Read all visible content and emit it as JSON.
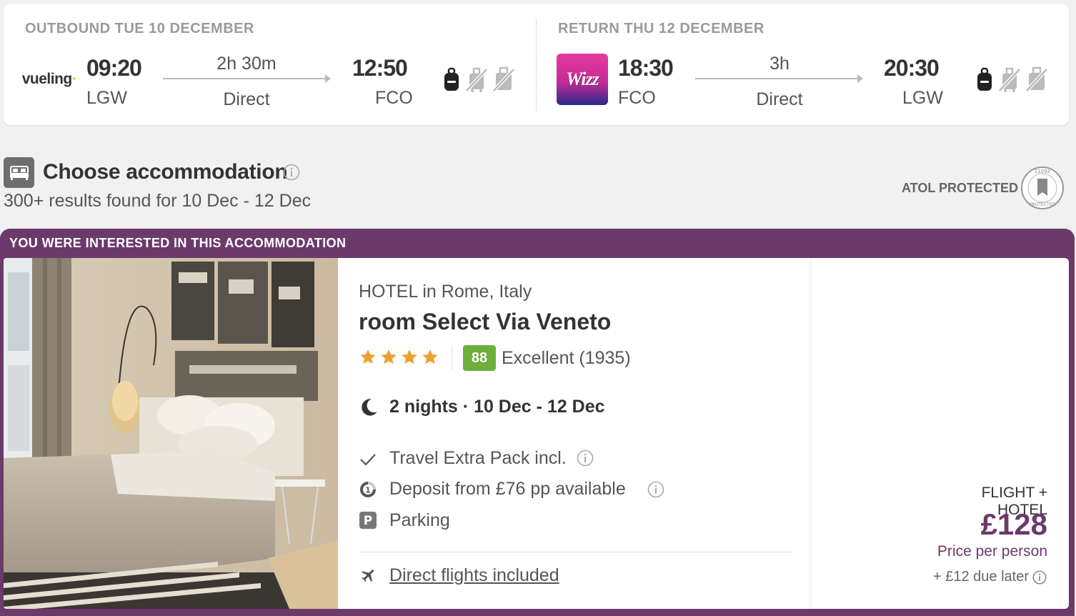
{
  "outbound": {
    "title": "OUTBOUND TUE 10 DECEMBER",
    "airline": "vueling",
    "depart_time": "09:20",
    "depart_code": "LGW",
    "duration": "2h 30m",
    "stops": "Direct",
    "arrive_time": "12:50",
    "arrive_code": "FCO",
    "baggage_icons": [
      "backpack-icon",
      "no-cabin-bag-icon",
      "no-checked-bag-icon"
    ]
  },
  "return": {
    "title": "RETURN THU 12 DECEMBER",
    "airline": "wizz",
    "depart_time": "18:30",
    "depart_code": "FCO",
    "duration": "3h",
    "stops": "Direct",
    "arrive_time": "20:30",
    "arrive_code": "LGW",
    "baggage_icons": [
      "backpack-icon",
      "no-cabin-bag-icon",
      "no-checked-bag-icon"
    ]
  },
  "accommodation": {
    "title": "Choose accommodation",
    "results": "300+ results found for 10 Dec - 12 Dec",
    "atol": "ATOL PROTECTED",
    "atol_seal": "11092 PROTECTED"
  },
  "hotel": {
    "banner": "YOU WERE INTERESTED IN THIS ACCOMMODATION",
    "type": "HOTEL in Rome, Italy",
    "name": "room Select Via Veneto",
    "stars": 4,
    "score": "88",
    "rating_text": "Excellent (1935)",
    "nights": "2 nights · 10 Dec - 12 Dec",
    "features": [
      {
        "icon": "check-icon",
        "label": "Travel Extra Pack incl.",
        "info": true
      },
      {
        "icon": "deposit-icon",
        "label": "Deposit from £76 pp available",
        "info": true
      },
      {
        "icon": "parking-icon",
        "label": "Parking",
        "info": false
      }
    ],
    "flights_link": "Direct flights included"
  },
  "price": {
    "label": "FLIGHT + HOTEL",
    "amount": "£128",
    "per_person": "Price per person",
    "due_later": "+ £12 due later"
  },
  "colors": {
    "brand_purple": "#6b3a6b",
    "score_green": "#6fae3c",
    "star_orange": "#f0a030"
  }
}
